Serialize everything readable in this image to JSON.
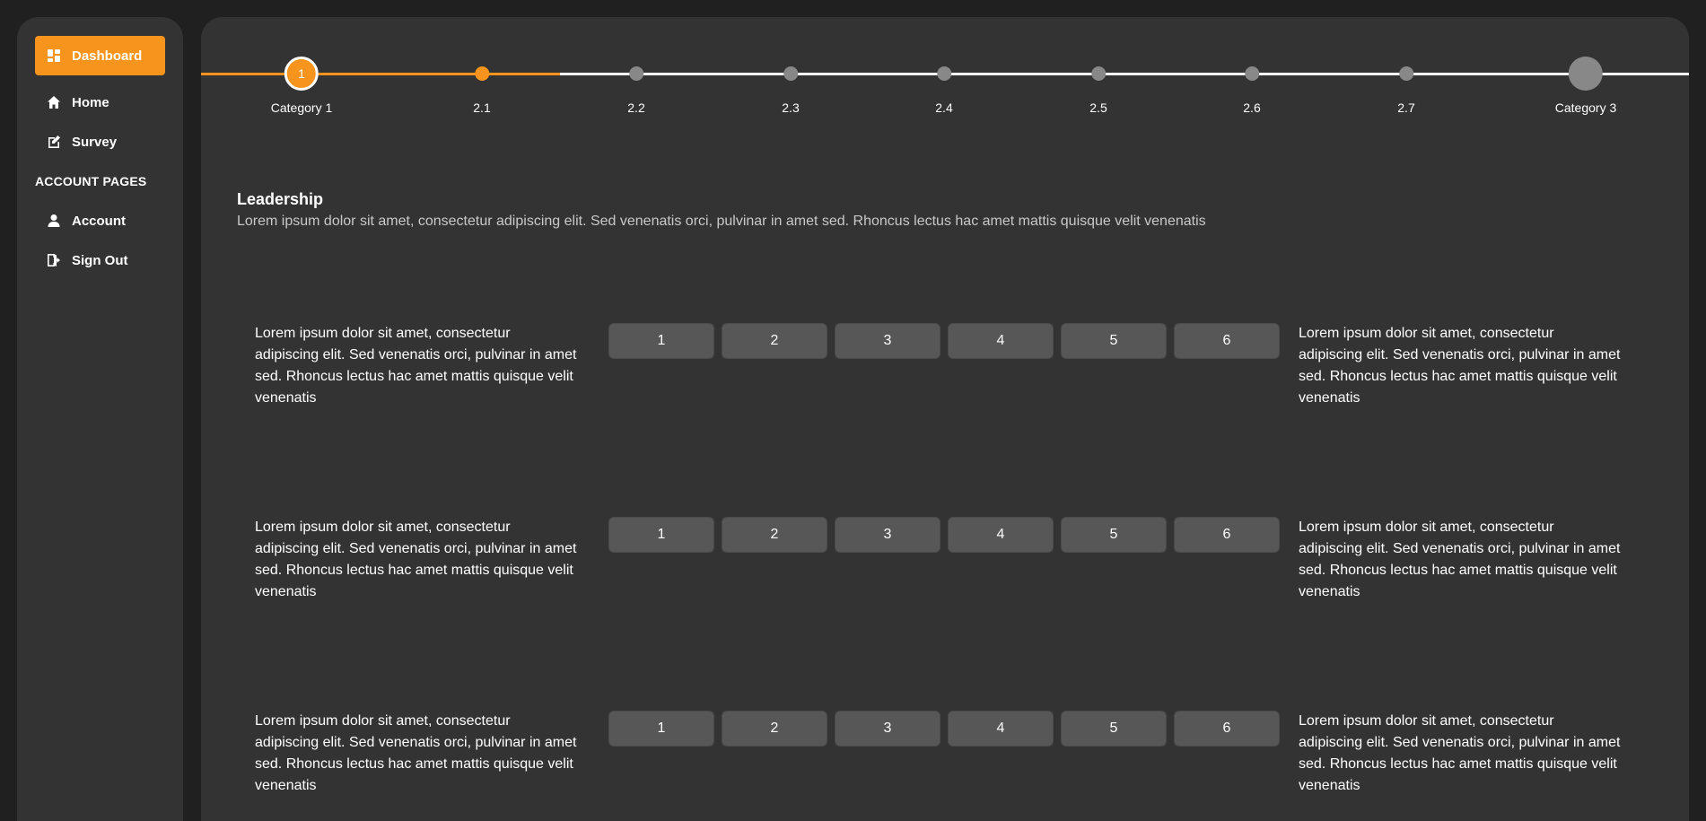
{
  "sidebar": {
    "items": [
      {
        "label": "Dashboard",
        "icon": "dashboard-icon",
        "active": true
      },
      {
        "label": "Home",
        "icon": "home-icon"
      },
      {
        "label": "Survey",
        "icon": "edit-icon"
      }
    ],
    "section_title": "ACCOUNT PAGES",
    "account_items": [
      {
        "label": "Account",
        "icon": "user-icon"
      },
      {
        "label": "Sign Out",
        "icon": "sign-out-icon"
      }
    ]
  },
  "stepper": {
    "steps": [
      {
        "label": "Category 1",
        "marker": "1",
        "state": "current"
      },
      {
        "label": "2.1",
        "state": "current-sub"
      },
      {
        "label": "2.2",
        "state": "pending"
      },
      {
        "label": "2.3",
        "state": "pending"
      },
      {
        "label": "2.4",
        "state": "pending"
      },
      {
        "label": "2.5",
        "state": "pending"
      },
      {
        "label": "2.6",
        "state": "pending"
      },
      {
        "label": "2.7",
        "state": "pending"
      },
      {
        "label": "Category 3",
        "state": "pending-major"
      }
    ]
  },
  "section": {
    "title": "Leadership",
    "description": "Lorem ipsum dolor sit amet, consectetur adipiscing elit. Sed venenatis orci, pulvinar in amet sed. Rhoncus lectus hac amet mattis quisque velit venenatis"
  },
  "questions": [
    {
      "left": "Lorem ipsum dolor sit amet, consectetur adipiscing elit. Sed venenatis orci, pulvinar in amet sed. Rhoncus lectus hac amet mattis quisque velit venenatis",
      "right": "Lorem ipsum dolor sit amet, consectetur adipiscing elit. Sed venenatis orci, pulvinar in amet sed. Rhoncus lectus hac amet mattis quisque velit venenatis",
      "options": [
        "1",
        "2",
        "3",
        "4",
        "5",
        "6"
      ]
    },
    {
      "left": "Lorem ipsum dolor sit amet, consectetur adipiscing elit. Sed venenatis orci, pulvinar in amet sed. Rhoncus lectus hac amet mattis quisque velit venenatis",
      "right": "Lorem ipsum dolor sit amet, consectetur adipiscing elit. Sed venenatis orci, pulvinar in amet sed. Rhoncus lectus hac amet mattis quisque velit venenatis",
      "options": [
        "1",
        "2",
        "3",
        "4",
        "5",
        "6"
      ]
    },
    {
      "left": "Lorem ipsum dolor sit amet, consectetur adipiscing elit. Sed venenatis orci, pulvinar in amet sed. Rhoncus lectus hac amet mattis quisque velit venenatis",
      "right": "Lorem ipsum dolor sit amet, consectetur adipiscing elit. Sed venenatis orci, pulvinar in amet sed. Rhoncus lectus hac amet mattis quisque velit venenatis",
      "options": [
        "1",
        "2",
        "3",
        "4",
        "5",
        "6"
      ]
    }
  ],
  "colors": {
    "accent": "#f7941d",
    "panel": "#333333",
    "background": "#202020",
    "scale_button": "#575757",
    "pending_dot": "#888888"
  }
}
